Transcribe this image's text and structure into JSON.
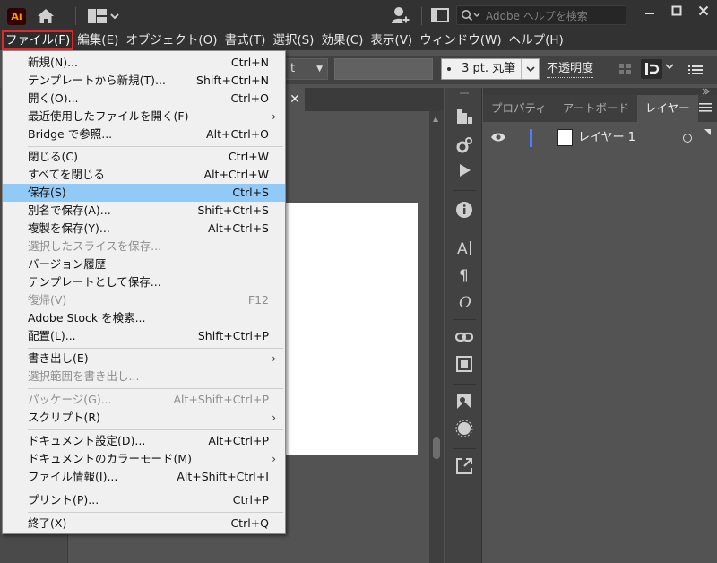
{
  "app": {
    "logo": "Ai"
  },
  "titlebar": {
    "search_placeholder": "Adobe ヘルプを検索"
  },
  "menubar": {
    "items": [
      "ファイル(F)",
      "編集(E)",
      "オブジェクト(O)",
      "書式(T)",
      "選択(S)",
      "効果(C)",
      "表示(V)",
      "ウィンドウ(W)",
      "ヘルプ(H)"
    ]
  },
  "controlbar": {
    "dropdown1": "t",
    "stroke_profile": "3 pt. 丸筆",
    "opacity_label": "不透明度"
  },
  "panel": {
    "tabs": [
      "プロパティ",
      "アートボード",
      "レイヤー"
    ],
    "layer_name": "レイヤー 1"
  },
  "file_menu": {
    "items": [
      {
        "label": "新規(N)...",
        "shortcut": "Ctrl+N"
      },
      {
        "label": "テンプレートから新規(T)...",
        "shortcut": "Shift+Ctrl+N"
      },
      {
        "label": "開く(O)...",
        "shortcut": "Ctrl+O"
      },
      {
        "label": "最近使用したファイルを開く(F)",
        "shortcut": ""
      },
      {
        "label": "Bridge で参照...",
        "shortcut": "Alt+Ctrl+O"
      },
      {
        "label": "閉じる(C)",
        "shortcut": "Ctrl+W"
      },
      {
        "label": "すべてを閉じる",
        "shortcut": "Alt+Ctrl+W"
      },
      {
        "label": "保存(S)",
        "shortcut": "Ctrl+S"
      },
      {
        "label": "別名で保存(A)...",
        "shortcut": "Shift+Ctrl+S"
      },
      {
        "label": "複製を保存(Y)...",
        "shortcut": "Alt+Ctrl+S"
      },
      {
        "label": "選択したスライスを保存...",
        "shortcut": ""
      },
      {
        "label": "バージョン履歴",
        "shortcut": ""
      },
      {
        "label": "テンプレートとして保存...",
        "shortcut": ""
      },
      {
        "label": "復帰(V)",
        "shortcut": "F12"
      },
      {
        "label": "Adobe Stock を検索...",
        "shortcut": ""
      },
      {
        "label": "配置(L)...",
        "shortcut": "Shift+Ctrl+P"
      },
      {
        "label": "書き出し(E)",
        "shortcut": ""
      },
      {
        "label": "選択範囲を書き出し...",
        "shortcut": ""
      },
      {
        "label": "パッケージ(G)...",
        "shortcut": "Alt+Shift+Ctrl+P"
      },
      {
        "label": "スクリプト(R)",
        "shortcut": ""
      },
      {
        "label": "ドキュメント設定(D)...",
        "shortcut": "Alt+Ctrl+P"
      },
      {
        "label": "ドキュメントのカラーモード(M)",
        "shortcut": ""
      },
      {
        "label": "ファイル情報(I)...",
        "shortcut": "Alt+Shift+Ctrl+I"
      },
      {
        "label": "プリント(P)...",
        "shortcut": "Ctrl+P"
      },
      {
        "label": "終了(X)",
        "shortcut": "Ctrl+Q"
      }
    ]
  },
  "colors": {
    "accent_highlight": "#91c9f7",
    "active_menu_outline": "#e0282e",
    "layer_color": "#4f7bff"
  }
}
